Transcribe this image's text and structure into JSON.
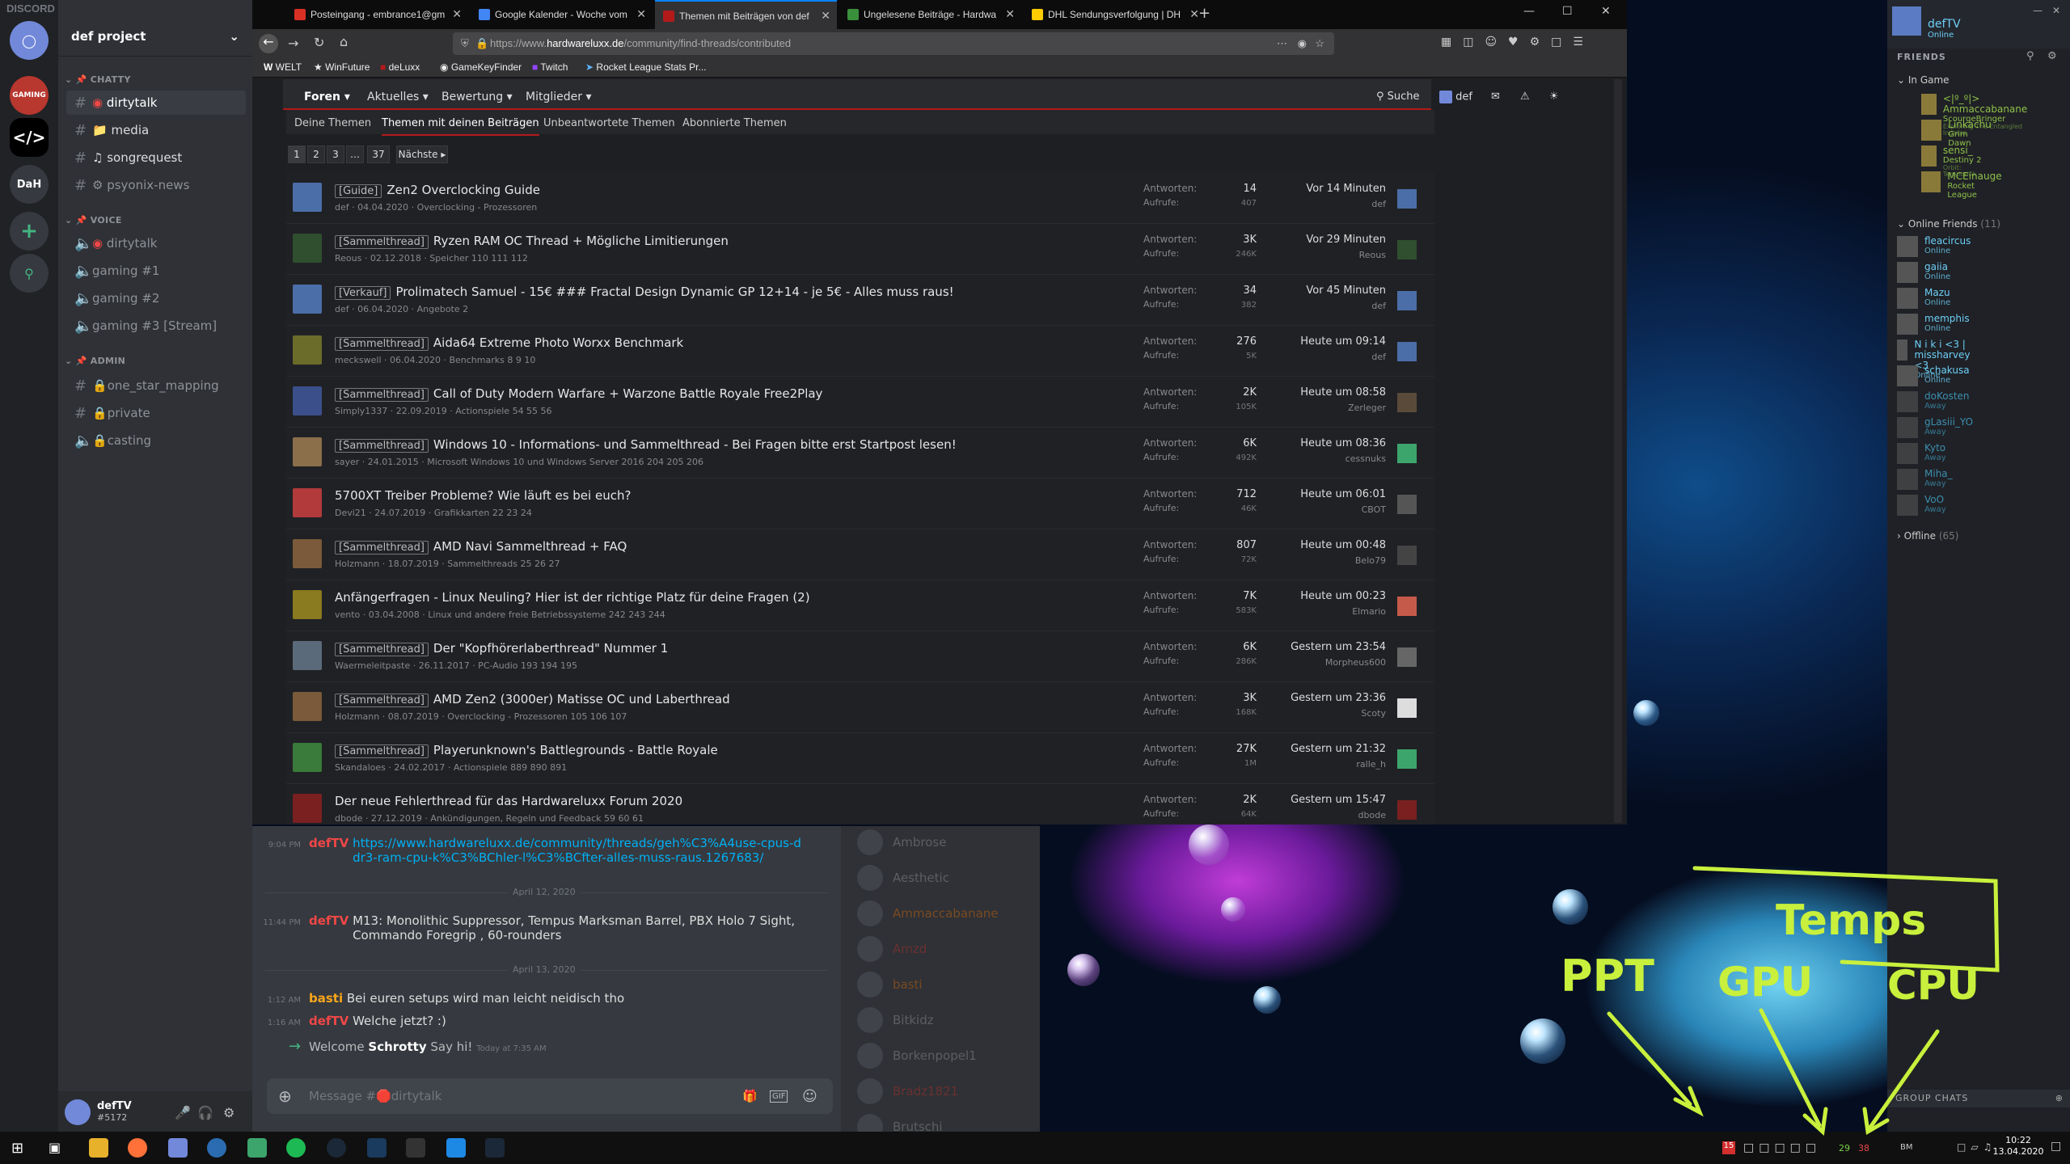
{
  "discord": {
    "app_title": "DISCORD",
    "server_name": "def project",
    "guilds": [
      "GAMING",
      "DaH"
    ],
    "categories": {
      "chatty": "CHATTY",
      "voice": "VOICE",
      "admin": "ADMIN"
    },
    "text_channels": [
      {
        "name": "dirtytalk"
      },
      {
        "name": "media"
      },
      {
        "name": "songrequest"
      },
      {
        "name": "psyonix-news"
      }
    ],
    "voice_channels": [
      {
        "name": "dirtytalk"
      },
      {
        "name": "gaming #1"
      },
      {
        "name": "gaming #2"
      },
      {
        "name": "gaming #3 [Stream]"
      }
    ],
    "admin_channels": [
      {
        "name": "one_star_mapping"
      },
      {
        "name": "private"
      },
      {
        "name": "casting"
      }
    ],
    "user": {
      "name": "defTV",
      "tag": "#5172"
    },
    "messages": [
      {
        "time": "9:04 PM",
        "author": "defTV",
        "text": "https://www.hardwareluxx.de/community/threads/geh%C3%A4use-cpus-ddr3-ram-cpu-k%C3%BChler-l%C3%BCfter-alles-muss-raus.1267683/"
      },
      {
        "divider": "April 12, 2020"
      },
      {
        "time": "11:44 PM",
        "author": "defTV",
        "text": "M13: Monolithic Suppressor, Tempus Marksman Barrel, PBX Holo 7 Sight, Commando Foregrip , 60-rounders"
      },
      {
        "divider": "April 13, 2020"
      },
      {
        "time": "1:12 AM",
        "author": "basti",
        "text": "Bei euren setups wird man leicht neidisch tho"
      },
      {
        "time": "1:16 AM",
        "author": "defTV",
        "text": "Welche jetzt? :)"
      },
      {
        "time": "",
        "author": "",
        "text": "Welcome Schrotty Say hi!",
        "sys_time": "Today at 7:35 AM"
      }
    ],
    "dividers": [
      "April 12, 2020",
      "April 13, 2020"
    ],
    "input_placeholder": "Message #🛑dirtytalk",
    "welcome_prefix": "Welcome",
    "welcome_name": "Schrotty",
    "welcome_suffix": "Say hi!",
    "welcome_time": "Today at 7:35 AM",
    "members": [
      "Ambrose",
      "Aesthetic",
      "Ammaccabanane",
      "Amzd",
      "basti",
      "Bitkidz",
      "Borkenpopel1",
      "Bradz1821",
      "Brutschi"
    ]
  },
  "firefox": {
    "tabs": [
      {
        "label": "Posteingang - embrance1@gm",
        "color": "#d93025"
      },
      {
        "label": "Google Kalender - Woche vom",
        "color": "#4285f4"
      },
      {
        "label": "Themen mit Beiträgen von def",
        "color": "#b21a1a"
      },
      {
        "label": "Ungelesene Beiträge - Hardwa",
        "color": "#3a8f3a"
      },
      {
        "label": "DHL Sendungsverfolgung | DH",
        "color": "#ffcc00"
      }
    ],
    "url_prefix": "https://www.",
    "url_domain": "hardwareluxx.de",
    "url_path": "/community/find-threads/contributed",
    "bookmarks": [
      "WELT",
      "WinFuture",
      "deLuxx",
      "GameKeyFinder",
      "Twitch",
      "Rocket League Stats Pr..."
    ]
  },
  "forum": {
    "nav": [
      "Foren",
      "Aktuelles",
      "Bewertung",
      "Mitglieder"
    ],
    "nav_right": {
      "search": "Suche",
      "user": "def"
    },
    "subnav": [
      "Deine Themen",
      "Themen mit deinen Beiträgen",
      "Unbeantwortete Themen",
      "Abonnierte Themen"
    ],
    "pages": [
      "1",
      "2",
      "3",
      "…",
      "37",
      "Nächste"
    ],
    "replies_label": "Antworten:",
    "views_label": "Aufrufe:",
    "threads": [
      {
        "prefix": "[Guide]",
        "title": "Zen2 Overclocking Guide",
        "meta": "def · 04.04.2020 · Overclocking - Prozessoren",
        "replies": "14",
        "views": "407",
        "last": "Vor 14 Minuten",
        "last_user": "def"
      },
      {
        "prefix": "[Sammelthread]",
        "title": "Ryzen RAM OC Thread + Mögliche Limitierungen",
        "meta": "Reous · 02.12.2018 · Speicher  110 111 112",
        "replies": "3K",
        "views": "246K",
        "last": "Vor 29 Minuten",
        "last_user": "Reous"
      },
      {
        "prefix": "[Verkauf]",
        "title": "Prolimatech Samuel - 15€ ### Fractal Design Dynamic GP 12+14 - je 5€ - Alles muss raus!",
        "meta": "def · 06.04.2020 · Angebote  2",
        "replies": "34",
        "views": "382",
        "last": "Vor 45 Minuten",
        "last_user": "def"
      },
      {
        "prefix": "[Sammelthread]",
        "title": "Aida64 Extreme Photo Worxx Benchmark",
        "meta": "meckswell · 06.04.2020 · Benchmarks  8 9 10",
        "replies": "276",
        "views": "5K",
        "last": "Heute um 09:14",
        "last_user": "def"
      },
      {
        "prefix": "[Sammelthread]",
        "title": "Call of Duty Modern Warfare + Warzone Battle Royale Free2Play",
        "meta": "Simply1337 · 22.09.2019 · Actionspiele  54 55 56",
        "replies": "2K",
        "views": "105K",
        "last": "Heute um 08:58",
        "last_user": "Zerleger"
      },
      {
        "prefix": "[Sammelthread]",
        "title": "Windows 10 - Informations- und Sammelthread - Bei Fragen bitte erst Startpost lesen!",
        "meta": "sayer · 24.01.2015 · Microsoft Windows 10 und Windows Server 2016  204 205 206",
        "replies": "6K",
        "views": "492K",
        "last": "Heute um 08:36",
        "last_user": "cessnuks"
      },
      {
        "prefix": "",
        "title": "5700XT Treiber Probleme? Wie läuft es bei euch?",
        "meta": "Devi21 · 24.07.2019 · Grafikkarten  22 23 24",
        "replies": "712",
        "views": "46K",
        "last": "Heute um 06:01",
        "last_user": "CBOT"
      },
      {
        "prefix": "[Sammelthread]",
        "title": "AMD Navi Sammelthread + FAQ",
        "meta": "Holzmann · 18.07.2019 · Sammelthreads  25 26 27",
        "replies": "807",
        "views": "72K",
        "last": "Heute um 00:48",
        "last_user": "Belo79"
      },
      {
        "prefix": "",
        "title": "Anfängerfragen - Linux Neuling? Hier ist der richtige Platz für deine Fragen (2)",
        "meta": "vento · 03.04.2008 · Linux und andere freie Betriebssysteme  242 243 244",
        "replies": "7K",
        "views": "583K",
        "last": "Heute um 00:23",
        "last_user": "Elmario"
      },
      {
        "prefix": "[Sammelthread]",
        "title": "Der \"Kopfhörerlaberthread\" Nummer 1",
        "meta": "Waermeleitpaste · 26.11.2017 · PC-Audio  193 194 195",
        "replies": "6K",
        "views": "286K",
        "last": "Gestern um 23:54",
        "last_user": "Morpheus600"
      },
      {
        "prefix": "[Sammelthread]",
        "title": "AMD Zen2 (3000er) Matisse OC und Laberthread",
        "meta": "Holzmann · 08.07.2019 · Overclocking - Prozessoren  105 106 107",
        "replies": "3K",
        "views": "168K",
        "last": "Gestern um 23:36",
        "last_user": "Scoty"
      },
      {
        "prefix": "[Sammelthread]",
        "title": "Playerunknown's Battlegrounds - Battle Royale",
        "meta": "Skandaloes · 24.02.2017 · Actionspiele  889 890 891",
        "replies": "27K",
        "views": "1M",
        "last": "Gestern um 21:32",
        "last_user": "ralle_h"
      },
      {
        "prefix": "",
        "title": "Der neue Fehlerthread für das Hardwareluxx Forum 2020",
        "meta": "dbode · 27.12.2019 · Ankündigungen, Regeln und Feedback  59 60 61",
        "replies": "2K",
        "views": "64K",
        "last": "Gestern um 15:47",
        "last_user": "dbode"
      }
    ]
  },
  "steam": {
    "user": "defTV",
    "status": "Online",
    "friends_label": "FRIENDS",
    "in_game_label": "In Game",
    "in_game": [
      {
        "name": "<|º_º|> Ammaccabanane",
        "game": "ScourgeBringer",
        "detail": "Exploring The Entangled Ingress"
      },
      {
        "name": "Linkachu",
        "game": "Grim Dawn"
      },
      {
        "name": "sensi_",
        "game": "Destiny 2",
        "detail": "Orbit: Tempomik"
      },
      {
        "name": "MCEinauge",
        "game": "Rocket League"
      }
    ],
    "online_label": "Online Friends",
    "online_count": "(11)",
    "online": [
      {
        "name": "fleacircus",
        "status": "Online"
      },
      {
        "name": "gaiia",
        "status": "Online"
      },
      {
        "name": "Mazu",
        "status": "Online"
      },
      {
        "name": "memphis",
        "status": "Online"
      },
      {
        "name": "N i k i <3 | missharvey <3",
        "status": "Online"
      },
      {
        "name": "schakusa",
        "status": "Online"
      },
      {
        "name": "doKosten",
        "status": "Away"
      },
      {
        "name": "gLasiii_YO",
        "status": "Away"
      },
      {
        "name": "Kyto",
        "status": "Away"
      },
      {
        "name": "Miha_",
        "status": "Away"
      },
      {
        "name": "VoO",
        "status": "Away"
      }
    ],
    "offline_label": "Offline",
    "offline_count": "(65)",
    "group_chats": "GROUP CHATS"
  },
  "annotation": {
    "temps": "Temps",
    "ppt": "PPT",
    "gpu": "GPU",
    "cpu": "CPU",
    "color": "#c8f03c"
  },
  "taskbar": {
    "time": "10:22",
    "date": "13.04.2020",
    "tray": [
      "15",
      "29",
      "38"
    ],
    "tray_label": "BM"
  }
}
